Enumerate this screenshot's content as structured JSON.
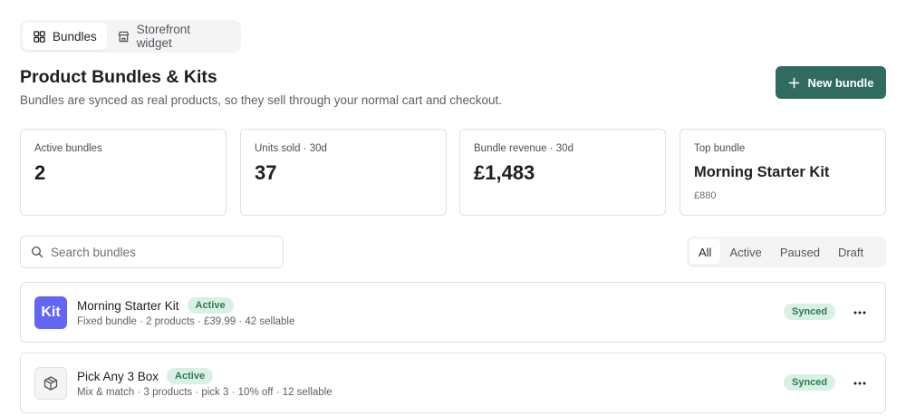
{
  "tabs": [
    {
      "label": "Bundles",
      "icon": "grid-icon",
      "active": true
    },
    {
      "label": "Storefront widget",
      "icon": "store-icon",
      "active": false
    }
  ],
  "header": {
    "title": "Product Bundles & Kits",
    "subtitle": "Bundles are synced as real products, so they sell through your normal cart and checkout.",
    "new_button": "New bundle"
  },
  "stats": [
    {
      "label": "Active bundles",
      "value": "2"
    },
    {
      "label": "Units sold · 30d",
      "value": "37"
    },
    {
      "label": "Bundle revenue · 30d",
      "value": "£1,483"
    },
    {
      "label": "Top bundle",
      "value": "Morning Starter Kit",
      "sub": "£880"
    }
  ],
  "search": {
    "placeholder": "Search bundles"
  },
  "filters": [
    "All",
    "Active",
    "Paused",
    "Draft"
  ],
  "bundles": [
    {
      "thumb": "Kit",
      "name": "Morning Starter Kit",
      "status": "Active",
      "meta": "Fixed bundle · 2 products · £39.99 · 42 sellable",
      "sync": "Synced"
    },
    {
      "thumb": "",
      "name": "Pick Any 3 Box",
      "status": "Active",
      "meta": "Mix & match · 3 products · pick 3 · 10% off · 12 sellable",
      "sync": "Synced"
    }
  ],
  "colors": {
    "accent": "#2f6b5f",
    "kit_thumb": "#6366f1",
    "badge_bg": "#d8f1e4",
    "badge_text": "#2f7a55"
  }
}
